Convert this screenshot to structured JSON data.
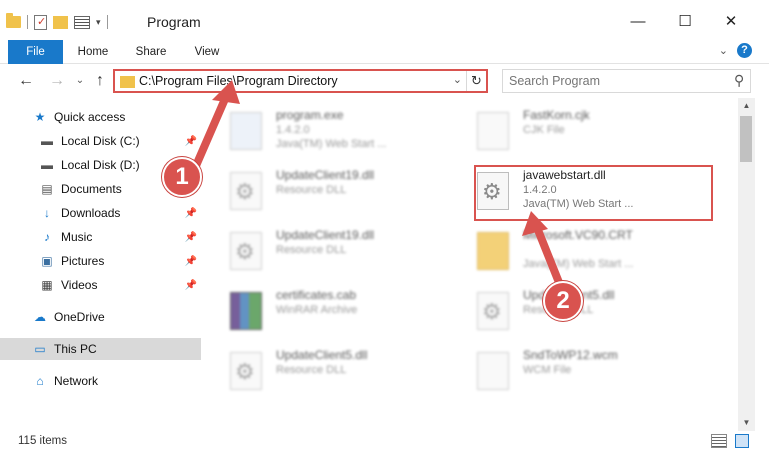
{
  "window": {
    "title": "Program",
    "minimize": "—",
    "maximize": "☐",
    "close": "✕"
  },
  "ribbon": {
    "tabs": [
      "File",
      "Home",
      "Share",
      "View"
    ],
    "help": "?",
    "collapse": "⌄"
  },
  "nav": {
    "back": "←",
    "forward": "→",
    "recent": "⌄",
    "up": "↑",
    "address": "C:\\Program Files\\Program Directory",
    "address_dropdown": "⌄",
    "refresh": "↻",
    "search_placeholder": "Search Program",
    "search_icon": "⚲"
  },
  "sidebar": {
    "items": [
      {
        "label": "Quick access",
        "icon": "star-icon",
        "glyph": "★",
        "pinned": false
      },
      {
        "label": "Local Disk (C:)",
        "icon": "disk-icon",
        "glyph": "▬",
        "pinned": true
      },
      {
        "label": "Local Disk (D:)",
        "icon": "disk-icon",
        "glyph": "▬",
        "pinned": true
      },
      {
        "label": "Documents",
        "icon": "documents-icon",
        "glyph": "▤",
        "pinned": true
      },
      {
        "label": "Downloads",
        "icon": "download-icon",
        "glyph": "↓",
        "pinned": true
      },
      {
        "label": "Music",
        "icon": "music-icon",
        "glyph": "♪",
        "pinned": true
      },
      {
        "label": "Pictures",
        "icon": "pictures-icon",
        "glyph": "▣",
        "pinned": true
      },
      {
        "label": "Videos",
        "icon": "videos-icon",
        "glyph": "▦",
        "pinned": true
      },
      {
        "label": "OneDrive",
        "icon": "cloud-icon",
        "glyph": "☁",
        "pinned": false
      },
      {
        "label": "This PC",
        "icon": "computer-icon",
        "glyph": "▭",
        "pinned": false
      },
      {
        "label": "Network",
        "icon": "network-icon",
        "glyph": "⌂",
        "pinned": false
      }
    ],
    "pin_glyph": "📌"
  },
  "files": [
    {
      "name": "program.exe",
      "line1": "1.4.2.0",
      "line2": "Java(TM) Web Start ...",
      "icon": "exe",
      "blurred": true
    },
    {
      "name": "FastKorn.cjk",
      "line1": "CJK File",
      "line2": "",
      "icon": "blank",
      "blurred": true
    },
    {
      "name": "UpdateClient19.dll",
      "line1": "Resource DLL",
      "line2": "",
      "icon": "gear",
      "blurred": true
    },
    {
      "name": "javawebstart.dll",
      "line1": "1.4.2.0",
      "line2": "Java(TM) Web Start ...",
      "icon": "gear",
      "blurred": false
    },
    {
      "name": "UpdateClient19.dll",
      "line1": "Resource DLL",
      "line2": "",
      "icon": "gear",
      "blurred": true
    },
    {
      "name": "Microsoft.VC90.CRT",
      "line1": "",
      "line2": "Java(TM) Web Start ...",
      "icon": "folderish",
      "blurred": true
    },
    {
      "name": "certificates.cab",
      "line1": "WinRAR Archive",
      "line2": "",
      "icon": "rar",
      "blurred": true
    },
    {
      "name": "UpdateClient5.dll",
      "line1": "Resource DLL",
      "line2": "",
      "icon": "gear",
      "blurred": true
    },
    {
      "name": "UpdateClient5.dll",
      "line1": "Resource DLL",
      "line2": "",
      "icon": "gear",
      "blurred": true
    },
    {
      "name": "SndToWP12.wcm",
      "line1": "WCM File",
      "line2": "",
      "icon": "blank",
      "blurred": true
    }
  ],
  "status": {
    "count": "115 items"
  },
  "annotations": {
    "callout1": "1",
    "callout2": "2",
    "color": "#d9534f"
  },
  "colors": {
    "accent": "#1979ca",
    "annotation": "#d9534f",
    "selected": "#d9d9d9"
  }
}
